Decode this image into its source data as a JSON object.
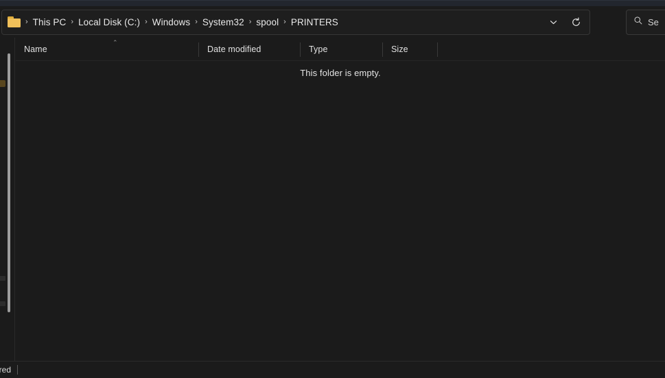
{
  "window": {
    "app": "File Explorer",
    "theme_background": "#1b1b1b",
    "chrome_strip_color": "#22262e"
  },
  "addressbar": {
    "folder_icon": "folder-icon",
    "breadcrumb": [
      {
        "label": "This PC"
      },
      {
        "label": "Local Disk  (C:)"
      },
      {
        "label": "Windows"
      },
      {
        "label": "System32"
      },
      {
        "label": "spool"
      },
      {
        "label": "PRINTERS"
      }
    ],
    "separator": "›",
    "history_dropdown_icon": "chevron-down-icon",
    "refresh_icon": "refresh-icon"
  },
  "search": {
    "icon": "search-icon",
    "placeholder": "Se"
  },
  "columns": [
    {
      "label": "Name",
      "sorted": true,
      "sort_direction": "ascending",
      "sort_caret": "⌃"
    },
    {
      "label": "Date modified"
    },
    {
      "label": "Type"
    },
    {
      "label": "Size"
    }
  ],
  "file_list": {
    "items": [],
    "empty_message": "This folder is empty."
  },
  "status_bar": {
    "text": "ared",
    "divider": true
  }
}
